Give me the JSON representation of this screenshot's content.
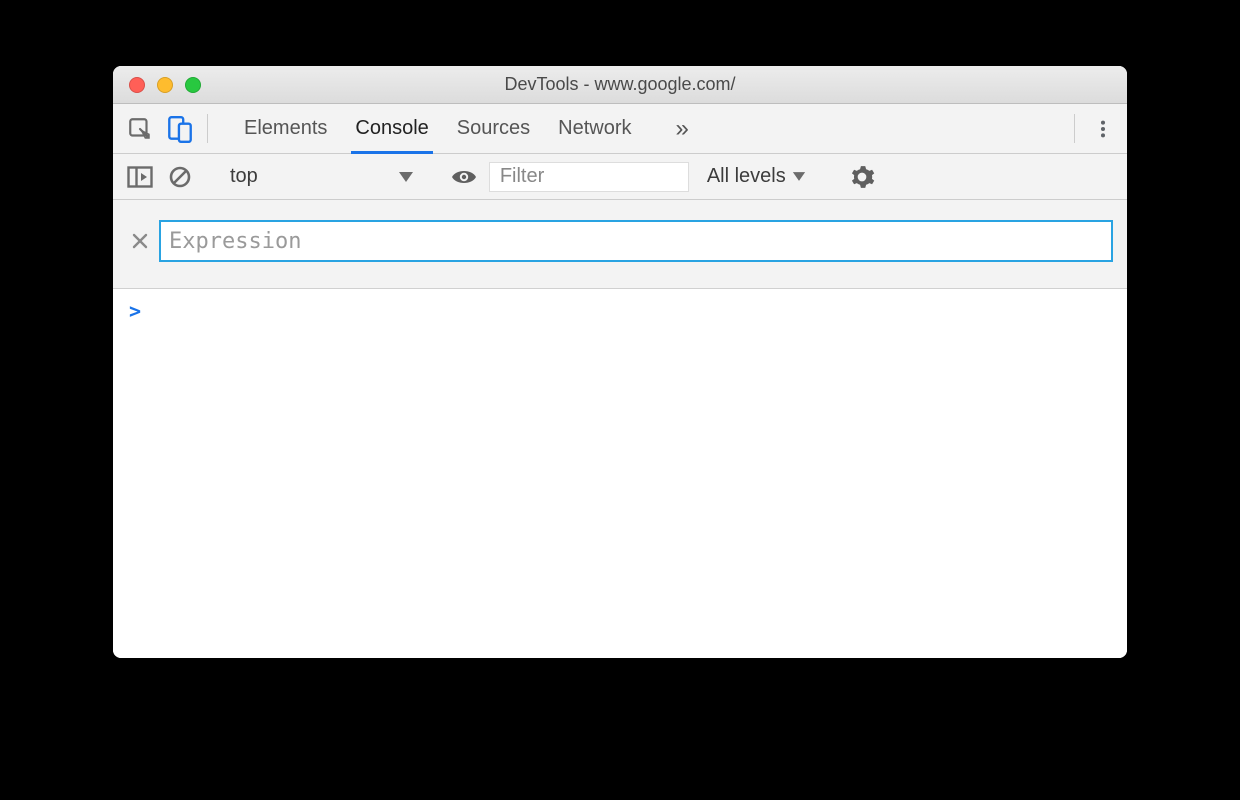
{
  "window": {
    "title": "DevTools - www.google.com/"
  },
  "tabs": {
    "items": [
      {
        "label": "Elements",
        "active": false
      },
      {
        "label": "Console",
        "active": true
      },
      {
        "label": "Sources",
        "active": false
      },
      {
        "label": "Network",
        "active": false
      }
    ],
    "overflow_glyph": "»"
  },
  "toolbar": {
    "context": "top",
    "filter_placeholder": "Filter",
    "levels_label": "All levels"
  },
  "expression": {
    "placeholder": "Expression"
  },
  "prompt": {
    "glyph": ">"
  }
}
